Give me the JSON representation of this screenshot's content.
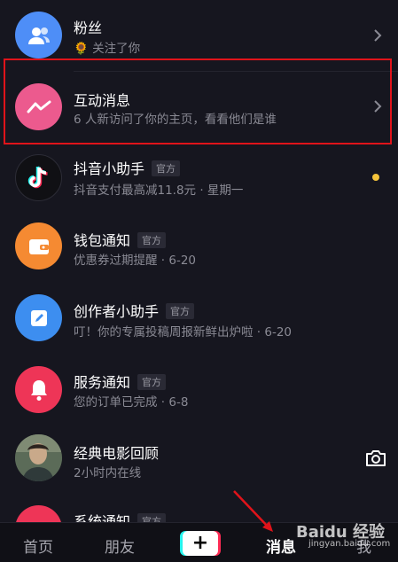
{
  "messages": [
    {
      "title": "粉丝",
      "subtitle": "🌻 关注了你",
      "badge": "",
      "icon": "users-icon",
      "color": "#4e8ef7"
    },
    {
      "title": "互动消息",
      "subtitle": "6 人新访问了你的主页，看看他们是谁",
      "badge": "",
      "icon": "wave-icon",
      "color": "#ec5a8e"
    },
    {
      "title": "抖音小助手",
      "subtitle": "抖音支付最高减11.8元 · 星期一",
      "badge": "官方",
      "icon": "tiktok-icon",
      "color": "#101014"
    },
    {
      "title": "钱包通知",
      "subtitle": "优惠券过期提醒 · 6-20",
      "badge": "官方",
      "icon": "wallet-icon",
      "color": "#f58a32"
    },
    {
      "title": "创作者小助手",
      "subtitle": "叮！你的专属投稿周报新鲜出炉啦 · 6-20",
      "badge": "官方",
      "icon": "edit-icon",
      "color": "#3d8ef0"
    },
    {
      "title": "服务通知",
      "subtitle": "您的订单已完成 · 6-8",
      "badge": "官方",
      "icon": "bell-icon",
      "color": "#ee3557"
    },
    {
      "title": "经典电影回顾",
      "subtitle": "2小时内在线",
      "badge": "",
      "icon": "avatar-photo",
      "color": "#4a5a4a"
    },
    {
      "title": "系统通知",
      "subtitle": "",
      "badge": "官方",
      "icon": "system-icon",
      "color": "#ee3557"
    }
  ],
  "unread_dot_color": "#f5c43b",
  "highlight_color": "#e0131a",
  "tabbar": {
    "home": "首页",
    "friends": "朋友",
    "create": "+",
    "messages": "消息",
    "me": "我"
  },
  "watermark": {
    "text": "Baidu 经验",
    "sub": "jingyan.baidu.com"
  }
}
